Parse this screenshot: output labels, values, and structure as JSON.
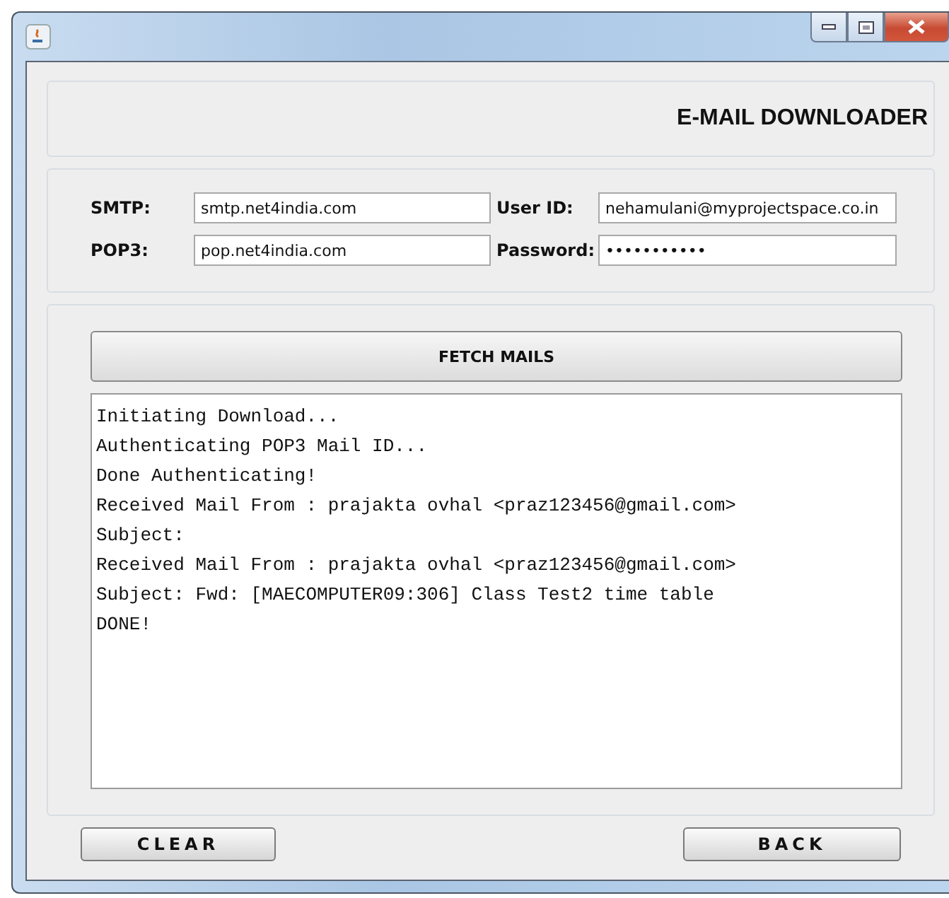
{
  "window": {
    "controls": [
      {
        "kind": "minimize"
      },
      {
        "kind": "maximize"
      },
      {
        "kind": "close"
      }
    ]
  },
  "header": {
    "title": "E-MAIL DOWNLOADER"
  },
  "form": {
    "fields": [
      {
        "label": "SMTP:",
        "value": "smtp.net4india.com"
      },
      {
        "label": "User ID:",
        "value": "nehamulani@myprojectspace.co.in"
      },
      {
        "label": "POP3:",
        "value": "pop.net4india.com"
      },
      {
        "label": "Password:",
        "value": "•••••••••••"
      }
    ]
  },
  "fetch_button": "FETCH MAILS",
  "log": [
    "Initiating Download...",
    "Authenticating POP3 Mail ID...",
    "Done Authenticating!",
    "Received Mail From : prajakta ovhal <praz123456@gmail.com>",
    "Subject:",
    "Received Mail From : prajakta ovhal <praz123456@gmail.com>",
    "Subject: Fwd: [MAECOMPUTER09:306] Class Test2 time table",
    "DONE!"
  ],
  "buttons": [
    "CLEAR",
    "BACK"
  ]
}
